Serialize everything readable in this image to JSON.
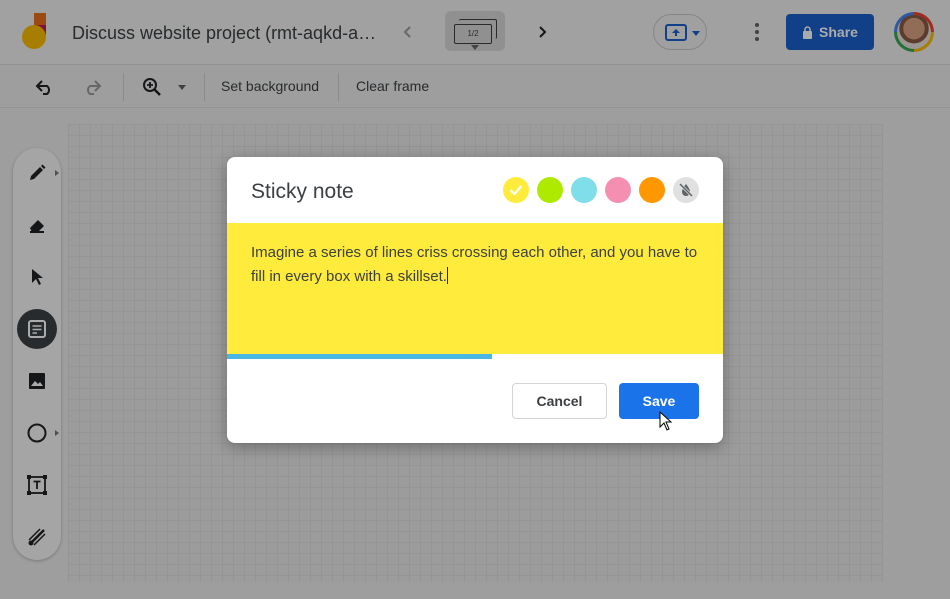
{
  "app": {
    "title": "Discuss website project (rmt-aqkd-ay…",
    "frame_counter": "1/2"
  },
  "header": {
    "share_label": "Share"
  },
  "toolbar": {
    "set_background_label": "Set background",
    "clear_frame_label": "Clear frame"
  },
  "tools": [
    {
      "name": "pen-tool",
      "icon": "pen-icon"
    },
    {
      "name": "eraser-tool",
      "icon": "eraser-icon"
    },
    {
      "name": "select-tool",
      "icon": "pointer-icon"
    },
    {
      "name": "sticky-note-tool",
      "icon": "sticky-note-icon",
      "active": true
    },
    {
      "name": "image-tool",
      "icon": "image-icon"
    },
    {
      "name": "shape-tool",
      "icon": "circle-icon"
    },
    {
      "name": "text-box-tool",
      "icon": "text-box-icon"
    },
    {
      "name": "laser-tool",
      "icon": "laser-icon"
    }
  ],
  "dialog": {
    "title": "Sticky note",
    "note_text": "Imagine a series of lines criss crossing each other, and you have to fill in every box with a skillset.",
    "note_color": "#ffeb3b",
    "swatches": [
      {
        "color": "#ffeb3b",
        "selected": true
      },
      {
        "color": "#aeea00",
        "selected": false
      },
      {
        "color": "#80deea",
        "selected": false
      },
      {
        "color": "#f48fb1",
        "selected": false
      },
      {
        "color": "#ff9800",
        "selected": false
      },
      {
        "color": "#e0e0e0",
        "selected": false,
        "icon": "no-color-icon"
      }
    ],
    "progress_fraction": 0.534,
    "progress_color": "#4ab6e3",
    "cancel_label": "Cancel",
    "save_label": "Save",
    "save_color": "#1a73e8"
  }
}
